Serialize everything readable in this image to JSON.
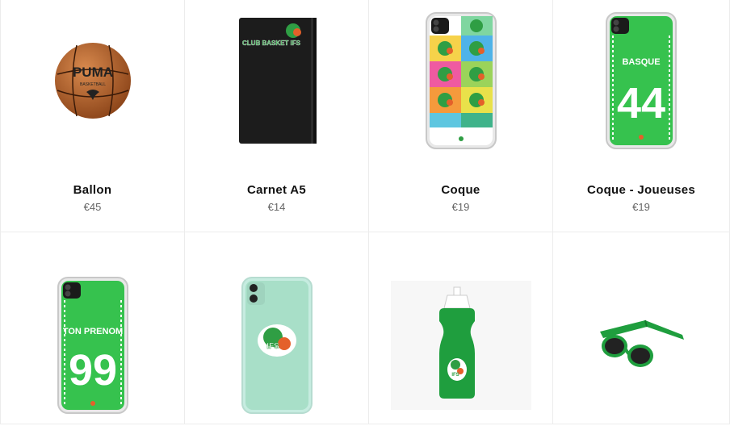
{
  "products": [
    {
      "name": "Ballon",
      "price": "€45",
      "image": "puma-basketball",
      "logo_text": "PUMA",
      "sub_text": "BASKETBALL"
    },
    {
      "name": "Carnet A5",
      "price": "€14",
      "image": "black-notebook",
      "logo_text": "CLUB BASKET IFS"
    },
    {
      "name": "Coque",
      "price": "€19",
      "image": "phone-case-popart"
    },
    {
      "name": "Coque - Joueuses",
      "price": "€19",
      "image": "phone-case-player",
      "case_name": "BASQUE",
      "case_number": "44"
    },
    {
      "name": "",
      "price": "",
      "image": "phone-case-custom",
      "case_name": "TON PRENOM",
      "case_number": "99"
    },
    {
      "name": "",
      "price": "",
      "image": "phone-case-mint",
      "logo_text": "IFS"
    },
    {
      "name": "",
      "price": "",
      "image": "green-water-bottle",
      "logo_text": "IFS"
    },
    {
      "name": "",
      "price": "",
      "image": "green-sunglasses"
    }
  ],
  "colors": {
    "green": "#1f9e3e",
    "case_green": "#36c24e",
    "mint": "#a8dfc8",
    "ball": "#b8632b"
  }
}
